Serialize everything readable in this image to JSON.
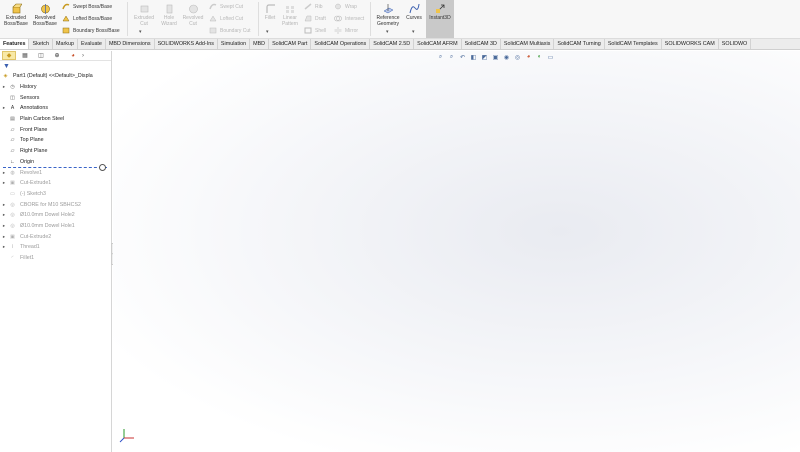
{
  "ribbon": {
    "extruded_boss": "Extruded Boss/Base",
    "revolved_boss": "Revolved Boss/Base",
    "swept_boss": "Swept Boss/Base",
    "lofted_boss": "Lofted Boss/Base",
    "boundary_boss": "Boundary Boss/Base",
    "extruded_cut": "Extruded Cut",
    "hole_wizard": "Hole Wizard",
    "revolved_cut": "Revolved Cut",
    "swept_cut": "Swept Cut",
    "lofted_cut": "Lofted Cut",
    "boundary_cut": "Boundary Cut",
    "fillet": "Fillet",
    "linear_pattern": "Linear Pattern",
    "rib": "Rib",
    "draft": "Draft",
    "shell": "Shell",
    "wrap": "Wrap",
    "intersect": "Intersect",
    "mirror": "Mirror",
    "reference_geometry": "Reference Geometry",
    "curves": "Curves",
    "instant3d": "Instant3D"
  },
  "tabs": [
    {
      "label": "Features",
      "active": true
    },
    {
      "label": "Sketch"
    },
    {
      "label": "Markup"
    },
    {
      "label": "Evaluate"
    },
    {
      "label": "MBD Dimensions"
    },
    {
      "label": "SOLIDWORKS Add-Ins"
    },
    {
      "label": "Simulation"
    },
    {
      "label": "MBD"
    },
    {
      "label": "SolidCAM Part"
    },
    {
      "label": "SolidCAM Operations"
    },
    {
      "label": "SolidCAM 2.5D"
    },
    {
      "label": "SolidCAM AFRM"
    },
    {
      "label": "SolidCAM 3D"
    },
    {
      "label": "SolidCAM Multiaxis"
    },
    {
      "label": "SolidCAM Turning"
    },
    {
      "label": "SolidCAM Templates"
    },
    {
      "label": "SOLIDWORKS CAM"
    },
    {
      "label": "SOLIDWO"
    }
  ],
  "tree": {
    "root": "Part1 (Default) <<Default>_Displa",
    "items": [
      {
        "label": "History",
        "expand": true,
        "icon": "history-icon",
        "sup": false
      },
      {
        "label": "Sensors",
        "expand": false,
        "icon": "sensors-icon",
        "sup": false
      },
      {
        "label": "Annotations",
        "expand": true,
        "icon": "annotations-icon",
        "sup": false
      },
      {
        "label": "Plain Carbon Steel",
        "expand": false,
        "icon": "material-icon",
        "sup": false
      },
      {
        "label": "Front Plane",
        "expand": false,
        "icon": "plane-icon",
        "sup": false
      },
      {
        "label": "Top Plane",
        "expand": false,
        "icon": "plane-icon",
        "sup": false
      },
      {
        "label": "Right Plane",
        "expand": false,
        "icon": "plane-icon",
        "sup": false
      },
      {
        "label": "Origin",
        "expand": false,
        "icon": "origin-icon",
        "sup": false
      }
    ],
    "rolled_back": [
      {
        "label": "Revolve1",
        "expand": true,
        "icon": "revolve-icon"
      },
      {
        "label": "Cut-Extrude1",
        "expand": true,
        "icon": "cut-extrude-icon"
      },
      {
        "label": "(-) Sketch3",
        "expand": false,
        "icon": "sketch-icon"
      },
      {
        "label": "CBORE for M10 SBHCS2",
        "expand": true,
        "icon": "hole-icon"
      },
      {
        "label": "Ø10.0mm Dowel Hole2",
        "expand": true,
        "icon": "hole-icon"
      },
      {
        "label": "Ø10.0mm Dowel Hole1",
        "expand": true,
        "icon": "hole-icon"
      },
      {
        "label": "Cut-Extrude2",
        "expand": true,
        "icon": "cut-extrude-icon"
      },
      {
        "label": "Thread1",
        "expand": true,
        "icon": "thread-icon"
      },
      {
        "label": "Fillet1",
        "expand": false,
        "icon": "fillet-icon"
      }
    ]
  },
  "colors": {
    "accent": "#3a64c8",
    "active_tab_panel": "#f8e9a7",
    "suppressed_text": "#9a9a9a",
    "instant3d_bg": "#c9c9c9"
  }
}
